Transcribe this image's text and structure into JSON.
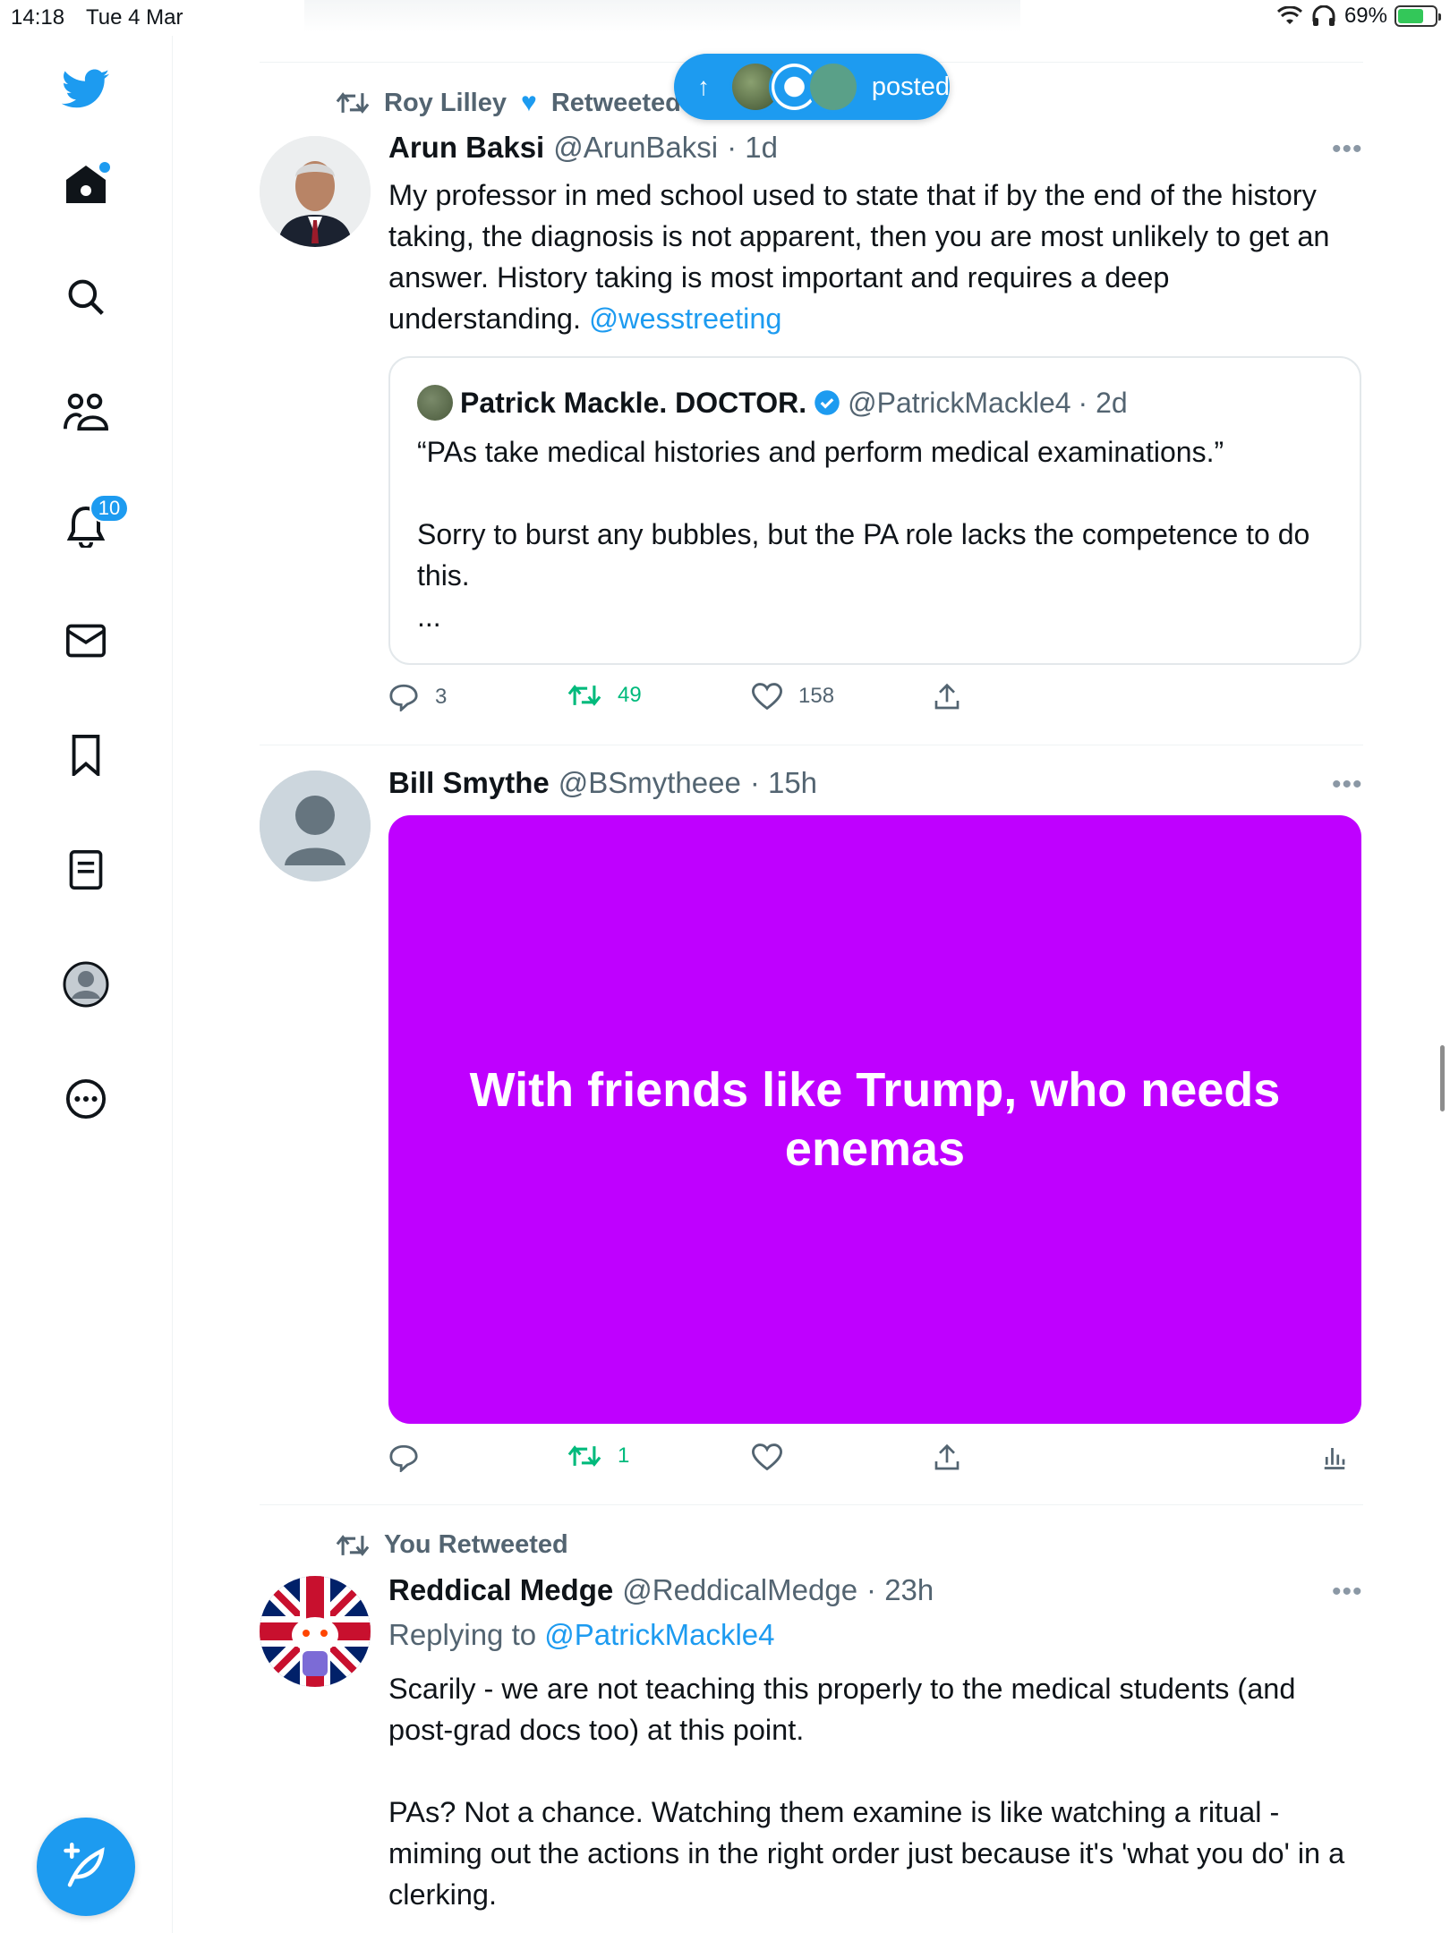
{
  "status_bar": {
    "time": "14:18",
    "date": "Tue 4 Mar",
    "battery": "69%"
  },
  "sidebar": {
    "notifications_badge": "10"
  },
  "new_posts_pill": {
    "label": "posted"
  },
  "tweets": [
    {
      "retweeted_by": "Roy Lilley",
      "retweeted_label": "Retweeted",
      "name": "Arun Baksi",
      "handle": "@ArunBaksi",
      "time": "· 1d",
      "text": "My professor in med school used to state that if by the end of the history taking, the diagnosis is not apparent, then you are most unlikely to get an answer. History taking is most important and requires a deep understanding. ",
      "mention": "@wesstreeting",
      "quote": {
        "name": "Patrick Mackle. DOCTOR.",
        "handle": "@PatrickMackle4",
        "time": "· 2d",
        "text": "“PAs take medical histories and perform medical examinations.”\n\nSorry to burst any bubbles, but the PA role lacks the competence to do this.\n..."
      },
      "stats": {
        "replies": "3",
        "retweets": "49",
        "likes": "158"
      }
    },
    {
      "name": "Bill Smythe",
      "handle": "@BSmytheee",
      "time": "· 15h",
      "media_text": "With friends like Trump, who needs enemas",
      "media_color": "#bf00ff",
      "stats": {
        "replies": "",
        "retweets": "1",
        "likes": ""
      }
    },
    {
      "retweeted_label": "You Retweeted",
      "name": "Reddical Medge",
      "handle": "@ReddicalMedge",
      "time": "· 23h",
      "replying_prefix": "Replying to ",
      "replying_to": "@PatrickMackle4",
      "text": "Scarily - we are not teaching this properly to the medical students (and post-grad docs too) at this point.\n\nPAs? Not a chance. Watching them examine is like watching a ritual - miming out the actions in the right order just because it's 'what you do' in a clerking."
    }
  ],
  "colors": {
    "accent": "#1d9bf0",
    "retweet_green": "#00ba7c",
    "text_secondary": "#536471"
  }
}
